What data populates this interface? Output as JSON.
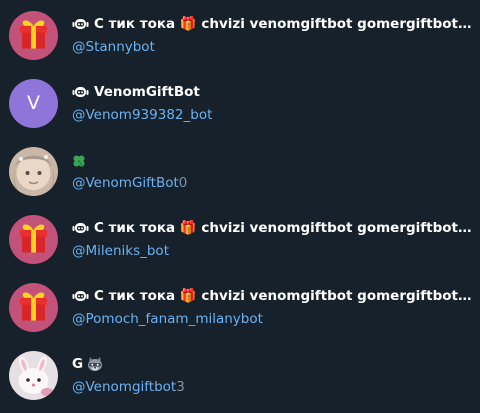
{
  "results": [
    {
      "name": "С тик тока 🎁 chvizi venomgiftbot gomergiftbot bymaxbot",
      "display_name": "С тик тока 🎁 chvizi venomgiftbot gomergiftbot bym…",
      "username": "@Stannybot",
      "username_suffix": "",
      "avatar": "gift-box-icon",
      "is_bot": true
    },
    {
      "name": "VenomGiftBot",
      "display_name": "VenomGiftBot",
      "username": "@Venom939382_bot",
      "username_suffix": "",
      "avatar": "letter-avatar",
      "avatar_letter": "V",
      "is_bot": true
    },
    {
      "name": "🍀",
      "display_name": "🍀",
      "username": "@VenomGiftBot",
      "username_suffix": "0",
      "avatar": "photo-avatar",
      "is_bot": false
    },
    {
      "name": "С тик тока 🎁 chvizi venomgiftbot gomergiftbot bymaxbot",
      "display_name": "С тик тока 🎁 chvizi venomgiftbot gomergiftbot bym…",
      "username": "@Mileniks_bot",
      "username_suffix": "",
      "avatar": "gift-box-icon",
      "is_bot": true
    },
    {
      "name": "С тик тока 🎁 chvizi venomgiftbot gomergiftbot bymaxbot",
      "display_name": "С тик тока 🎁 chvizi venomgiftbot gomergiftbot bym…",
      "username": "@Pomoch_fanam_milanybot",
      "username_suffix": "",
      "avatar": "gift-box-icon",
      "is_bot": true
    },
    {
      "name": "G 🦝",
      "display_name": "G 🦝",
      "username": "@Venomgiftbot",
      "username_suffix": "3",
      "avatar": "photo-avatar",
      "is_bot": false
    }
  ],
  "colors": {
    "background": "#17212b",
    "name": "#ffffff",
    "username": "#6ab2f2",
    "username_suffix": "#7f91a4",
    "gift_avatar_bg": "#c2527a",
    "letter_avatar_bg": "#8f75d9"
  }
}
